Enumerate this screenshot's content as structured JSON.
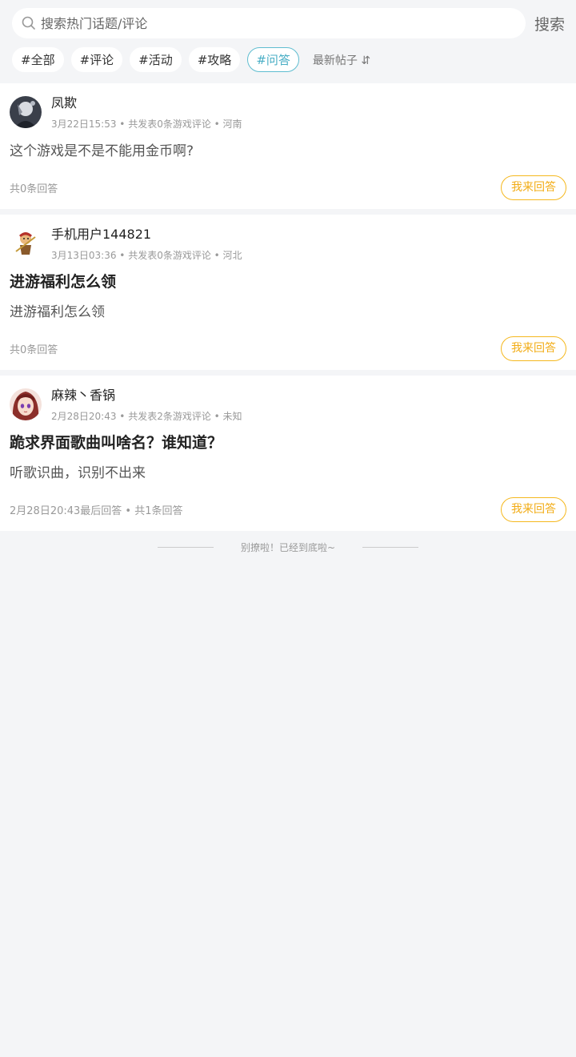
{
  "search": {
    "placeholder": "搜索热门话题/评论",
    "button_label": "搜索"
  },
  "tags": [
    {
      "label": "#全部",
      "active": false
    },
    {
      "label": "#评论",
      "active": false
    },
    {
      "label": "#活动",
      "active": false
    },
    {
      "label": "#攻略",
      "active": false
    },
    {
      "label": "#问答",
      "active": true
    }
  ],
  "sort": {
    "label": "最新帖子 ⇵"
  },
  "posts": [
    {
      "user": "凤欺",
      "meta": "3月22日15:53 • 共发表0条游戏评论 • 河南",
      "title": "",
      "body": "这个游戏是不是不能用金币啊?",
      "footer": "共0条回答",
      "answer_label": "我来回答"
    },
    {
      "user": "手机用户144821",
      "meta": "3月13日03:36 • 共发表0条游戏评论 • 河北",
      "title": "进游福利怎么领",
      "body": "进游福利怎么领",
      "footer": "共0条回答",
      "answer_label": "我来回答"
    },
    {
      "user": "麻辣丶香锅",
      "meta": "2月28日20:43 • 共发表2条游戏评论 • 未知",
      "title": "跪求界面歌曲叫啥名？谁知道？",
      "body": "听歌识曲，识别不出来",
      "footer": "2月28日20:43最后回答 • 共1条回答",
      "answer_label": "我来回答"
    }
  ],
  "end_text": "别撩啦！已经到底啦~",
  "colors": {
    "accent_tag": "#49aec5",
    "answer_button": "#f2ac15",
    "background": "#f4f5f7"
  }
}
